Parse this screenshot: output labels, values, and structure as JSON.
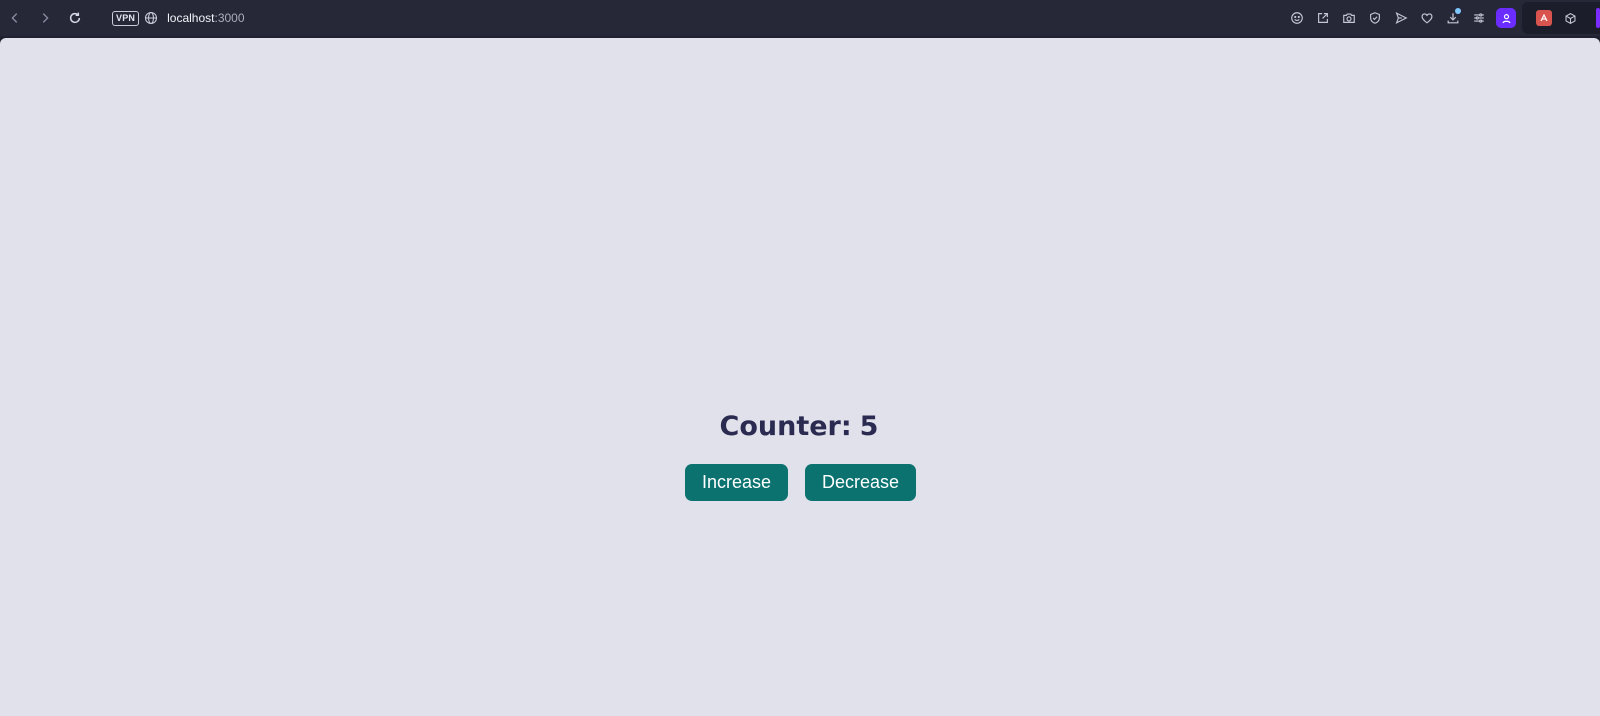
{
  "browser": {
    "vpn_label": "VPN",
    "url_host": "localhost",
    "url_port": ":3000",
    "toolbar_icons": [
      "smiley-icon",
      "share-icon",
      "camera-icon",
      "shield-icon",
      "send-icon",
      "heart-icon",
      "download-icon",
      "sliders-icon"
    ],
    "profile_color": "#6a2cff",
    "download_badge_color": "#7ec8ff",
    "extensions": [
      "red-extension-icon",
      "cube-icon"
    ]
  },
  "page": {
    "counter_label": "Counter:",
    "counter_value": "5",
    "buttons": {
      "increase": "Increase",
      "decrease": "Decrease"
    },
    "colors": {
      "background": "#e1e1ec",
      "title": "#2b2b52",
      "button": "#0b7270"
    }
  }
}
